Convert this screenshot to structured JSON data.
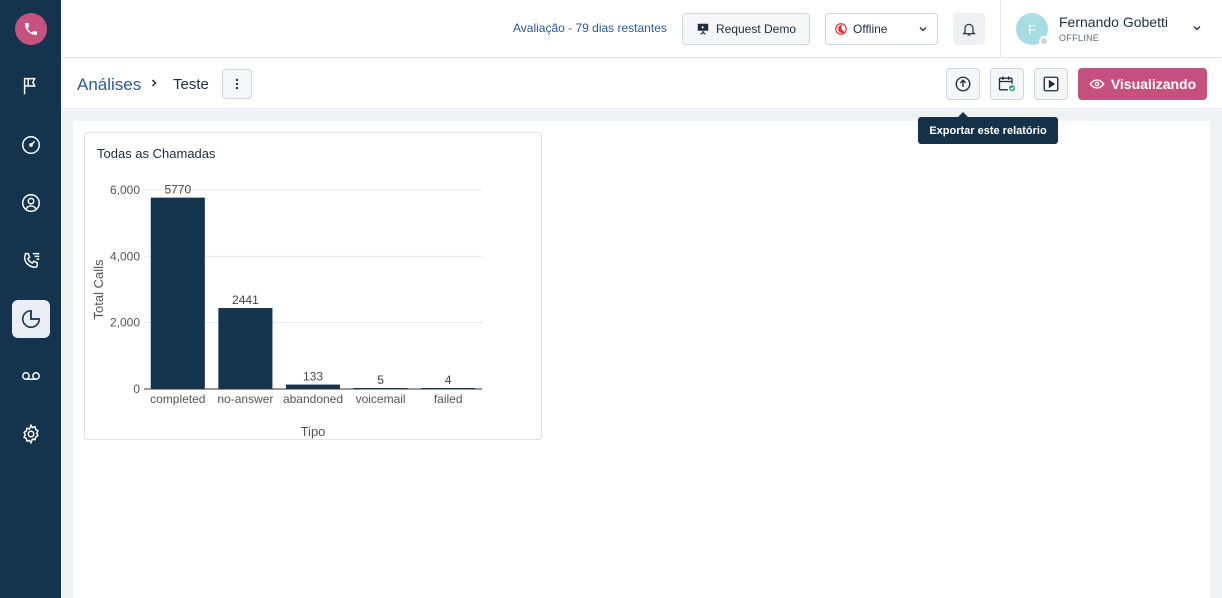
{
  "topbar": {
    "trial_text": "Avaliação - 79 dias restantes",
    "demo_label": "Request Demo",
    "status_value": "Offline",
    "user": {
      "initial": "F",
      "name": "Fernando Gobetti",
      "status": "OFFLINE"
    }
  },
  "sidebar": {
    "items": [
      {
        "icon": "flag-icon"
      },
      {
        "icon": "speedometer-icon"
      },
      {
        "icon": "user-circle-icon"
      },
      {
        "icon": "phone-list-icon"
      },
      {
        "icon": "pie-chart-icon",
        "active": true
      },
      {
        "icon": "voicemail-icon"
      },
      {
        "icon": "gear-icon"
      }
    ]
  },
  "breadcrumb": {
    "root": "Análises",
    "current": "Teste"
  },
  "actions": {
    "view_label": "Visualizando",
    "tooltip": "Exportar este relatório"
  },
  "colors": {
    "accent": "#c7517e",
    "sidebar": "#14344e",
    "bar": "#14344e",
    "link": "#2a5a9a"
  },
  "chart_data": {
    "type": "bar",
    "title": "Todas as Chamadas",
    "categories": [
      "completed",
      "no-answer",
      "abandoned",
      "voicemail",
      "failed"
    ],
    "values": [
      5770,
      2441,
      133,
      5,
      4
    ],
    "value_labels": [
      "5770",
      "2441",
      "133",
      "5",
      "4"
    ],
    "xlabel": "Tipo",
    "ylabel": "Total Calls",
    "ylim": [
      0,
      6000
    ],
    "yticks": [
      0,
      2000,
      4000,
      6000
    ],
    "ytick_labels": [
      "0",
      "2,000",
      "4,000",
      "6,000"
    ],
    "grid": true
  }
}
